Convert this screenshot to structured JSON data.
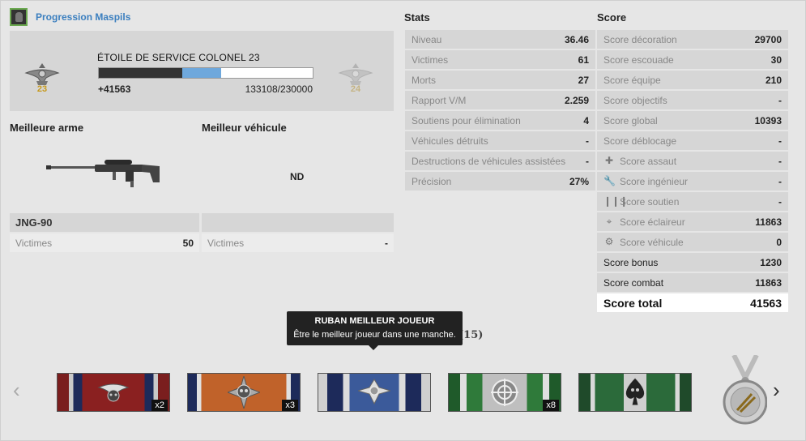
{
  "header": {
    "title": "Progression Maspils"
  },
  "rank": {
    "name": "ÉTOILE DE SERVICE COLONEL 23",
    "current_num": "23",
    "next_num": "24",
    "xp_gain": "+41563",
    "progress_text": "133108/230000",
    "bar_dark_fraction": 0.39,
    "bar_blue_fraction": 0.18
  },
  "best": {
    "weapon_heading": "Meilleure arme",
    "vehicle_heading": "Meilleur véhicule",
    "weapon_name": "JNG-90",
    "weapon_kills_label": "Victimes",
    "weapon_kills": "50",
    "vehicle_value": "ND",
    "vehicle_kills_label": "Victimes",
    "vehicle_kills": "-"
  },
  "stats": {
    "heading": "Stats",
    "rows": [
      {
        "label": "Niveau",
        "value": "36.46"
      },
      {
        "label": "Victimes",
        "value": "61"
      },
      {
        "label": "Morts",
        "value": "27"
      },
      {
        "label": "Rapport V/M",
        "value": "2.259"
      },
      {
        "label": "Soutiens pour élimination",
        "value": "4"
      },
      {
        "label": "Véhicules détruits",
        "value": "-"
      },
      {
        "label": "Destructions de véhicules assistées",
        "value": "-"
      },
      {
        "label": "Précision",
        "value": "27%"
      }
    ]
  },
  "score": {
    "heading": "Score",
    "rows": [
      {
        "label": "Score décoration",
        "value": "29700"
      },
      {
        "label": "Score escouade",
        "value": "30"
      },
      {
        "label": "Score équipe",
        "value": "210"
      },
      {
        "label": "Score objectifs",
        "value": "-"
      },
      {
        "label": "Score global",
        "value": "10393"
      },
      {
        "label": "Score déblocage",
        "value": "-"
      },
      {
        "label": "Score assaut",
        "value": "-",
        "icon": "plus-icon"
      },
      {
        "label": "Score ingénieur",
        "value": "-",
        "icon": "wrench-icon"
      },
      {
        "label": "Score soutien",
        "value": "-",
        "icon": "ammo-icon"
      },
      {
        "label": "Score éclaireur",
        "value": "11863",
        "icon": "crosshair-icon"
      },
      {
        "label": "Score véhicule",
        "value": "0",
        "icon": "gear-icon"
      },
      {
        "label": "Score bonus",
        "value": "1230"
      },
      {
        "label": "Score combat",
        "value": "11863"
      },
      {
        "label": "Score total",
        "value": "41563"
      }
    ]
  },
  "tooltip": {
    "title": "RUBAN MEILLEUR JOUEUR",
    "desc": "Être le meilleur joueur dans une manche.",
    "behind_text": "(15)"
  },
  "ribbons": [
    {
      "name": "eagle-ribbon",
      "count": "x2"
    },
    {
      "name": "skull-star-ribbon",
      "count": "x3"
    },
    {
      "name": "best-player-ribbon",
      "count": ""
    },
    {
      "name": "sniper-ribbon",
      "count": "x8"
    },
    {
      "name": "spade-skull-ribbon",
      "count": ""
    }
  ],
  "colors": {
    "accent": "#3b7fbf",
    "progress_blue": "#6fa8dc",
    "rank_gold": "#c79a1e"
  }
}
